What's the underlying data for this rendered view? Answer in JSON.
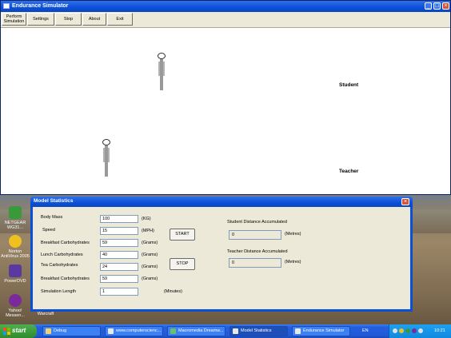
{
  "colors": {
    "titlebar": "#0c50d8",
    "taskbar": "#245ee0",
    "start": "#2e8c2e",
    "window_bg": "#ffffff",
    "dialog_bg": "#ece9d8"
  },
  "main_window": {
    "title": "Endurance Simulator",
    "controls": {
      "minimize": "_",
      "maximize": "□",
      "close": "×"
    },
    "menu": [
      "Perform Simulation",
      "Settings",
      "Stop",
      "About",
      "Exit"
    ],
    "labels": {
      "student": "Student",
      "teacher": "Teacher"
    }
  },
  "desktop_icons": [
    {
      "label": "NETGEAR WG31...",
      "icon": "netgear-icon",
      "color": "#3a9a3a"
    },
    {
      "label": "Norton AntiVirus 2005",
      "icon": "norton-icon",
      "color": "#f0c020"
    },
    {
      "label": "PowerDVD",
      "icon": "powerdvd-icon",
      "color": "#5a3aa0"
    },
    {
      "label": "Yahoo! Messen...",
      "icon": "yahoo-messenger-icon",
      "color": "#7a2a9a"
    },
    {
      "label": "World of Warcraft",
      "icon": "warcraft-icon",
      "color": "#6a5030"
    }
  ],
  "dialog": {
    "title": "Model Statistics",
    "close": "×",
    "fields": [
      {
        "label": "Body Mass",
        "value": "100",
        "unit": "(KG)"
      },
      {
        "label": "Speed",
        "value": "15",
        "unit": "(MPH)"
      },
      {
        "label": "Breakfast Carbohydrates",
        "value": "59",
        "unit": "(Grams)"
      },
      {
        "label": "Lunch Carbohydrates",
        "value": "40",
        "unit": "(Grams)"
      },
      {
        "label": "Tea Carbohydrates",
        "value": "24",
        "unit": "(Grams)"
      },
      {
        "label": "Breakfast Carbohydrates",
        "value": "59",
        "unit": "(Grams)"
      },
      {
        "label": "Simulation Length",
        "value": "1",
        "unit": "(Minutes)"
      }
    ],
    "buttons": {
      "start": "START",
      "stop": "STOP"
    },
    "student_distance": {
      "label": "Student Distance Accumulated",
      "value": "0",
      "unit": "(Metres)"
    },
    "teacher_distance": {
      "label": "Teacher Distance Accumulated",
      "value": "0",
      "unit": "(Metres)"
    }
  },
  "taskbar": {
    "start": "start",
    "items": [
      {
        "label": "Debug",
        "icon": "folder-icon"
      },
      {
        "label": "www.computerscienc...",
        "icon": "browser-icon"
      },
      {
        "label": "Macromedia Dreamw...",
        "icon": "dreamweaver-icon"
      },
      {
        "label": "Model Statistics",
        "icon": "window-icon"
      },
      {
        "label": "Endurance Simulator",
        "icon": "window-icon"
      }
    ],
    "lang": "EN",
    "clock": "10:21"
  }
}
